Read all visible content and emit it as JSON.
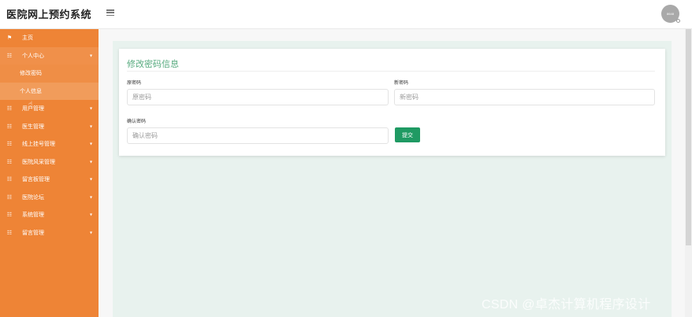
{
  "header": {
    "app_title": "医院网上预约系统",
    "avatar_text": "8648"
  },
  "sidebar": {
    "items": [
      {
        "label": "主页",
        "icon": "flag-icon"
      },
      {
        "label": "个人中心",
        "icon": "list-icon",
        "caret": "▾"
      },
      {
        "label": "用户管理",
        "icon": "list-icon",
        "caret": "▾"
      },
      {
        "label": "医生管理",
        "icon": "list-icon",
        "caret": "▾"
      },
      {
        "label": "线上挂号管理",
        "icon": "list-icon",
        "caret": "▾"
      },
      {
        "label": "医院风采管理",
        "icon": "list-icon",
        "caret": "▾"
      },
      {
        "label": "留言板管理",
        "icon": "list-icon",
        "caret": "▾"
      },
      {
        "label": "医院论坛",
        "icon": "list-icon",
        "caret": "▾"
      },
      {
        "label": "系统管理",
        "icon": "list-icon",
        "caret": "▾"
      },
      {
        "label": "留言管理",
        "icon": "list-icon",
        "caret": "▾"
      }
    ],
    "sub_items": [
      {
        "label": "修改密码"
      },
      {
        "label": "个人信息"
      }
    ]
  },
  "card": {
    "title": "修改密码信息",
    "fields": {
      "old_password": {
        "label": "原密码",
        "placeholder": "原密码"
      },
      "new_password": {
        "label": "新密码",
        "placeholder": "新密码"
      },
      "confirm_password": {
        "label": "确认密码",
        "placeholder": "确认密码"
      }
    },
    "submit_label": "提交"
  },
  "watermark": "CSDN @卓杰计算机程序设计",
  "colors": {
    "sidebar": "#ee8436",
    "accent_title": "#56aa7e",
    "submit_button": "#1f9a63",
    "content_background": "#e8f2ee"
  }
}
